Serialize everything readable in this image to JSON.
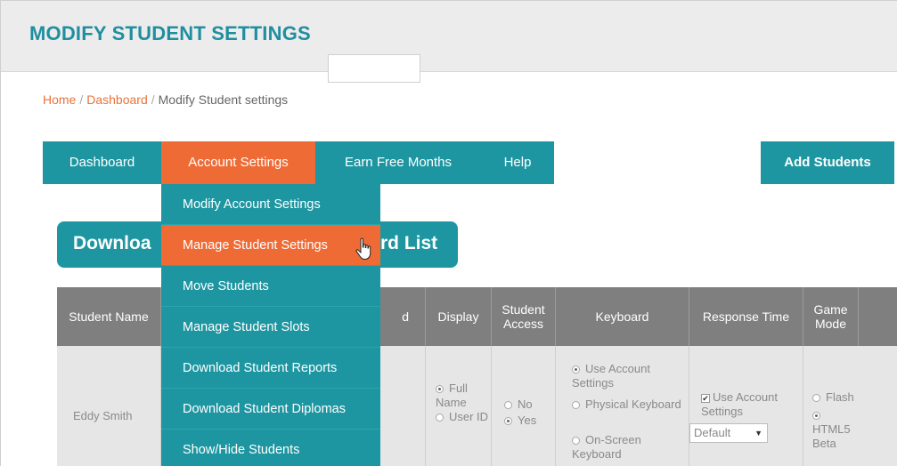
{
  "page": {
    "title": "MODIFY STUDENT SETTINGS"
  },
  "breadcrumb": {
    "home": "Home",
    "dashboard": "Dashboard",
    "current": "Modify Student settings",
    "separator": "/"
  },
  "nav": {
    "dashboard": "Dashboard",
    "account_settings": "Account Settings",
    "earn_free_months": "Earn Free Months",
    "help": "Help",
    "add_students": "Add Students"
  },
  "dropdown": {
    "items": [
      "Modify Account Settings",
      "Manage Student Settings",
      "Move Students",
      "Manage Student Slots",
      "Download Student Reports",
      "Download Student Diplomas",
      "Show/Hide Students"
    ],
    "active_index": 1
  },
  "banner": {
    "left_text": "Downloa",
    "right_text": "rd List"
  },
  "table": {
    "headers": {
      "student_name": "Student Name",
      "partial": "d",
      "display": "Display",
      "student_access": "Student Access",
      "keyboard": "Keyboard",
      "response_time": "Response Time",
      "game_mode": "Game Mode"
    },
    "row": {
      "student_name": "Eddy Smith",
      "display_options": [
        "Full Name",
        "User ID"
      ],
      "display_selected": "Full Name",
      "access_options": [
        "No",
        "Yes"
      ],
      "access_selected": "Yes",
      "keyboard_options": [
        "Use Account Settings",
        "Physical Keyboard",
        "On-Screen Keyboard"
      ],
      "keyboard_selected": "Use Account Settings",
      "response_checkbox_label": "Use Account Settings",
      "response_checkbox_checked": true,
      "response_select_value": "Default",
      "game_mode_options": [
        "Flash",
        "HTML5 Beta"
      ],
      "game_mode_selected": "HTML5 Beta"
    }
  },
  "colors": {
    "teal": "#1e96a1",
    "orange": "#ef6b35",
    "title": "#1f8fa0",
    "table_header": "#7f7f7f"
  }
}
